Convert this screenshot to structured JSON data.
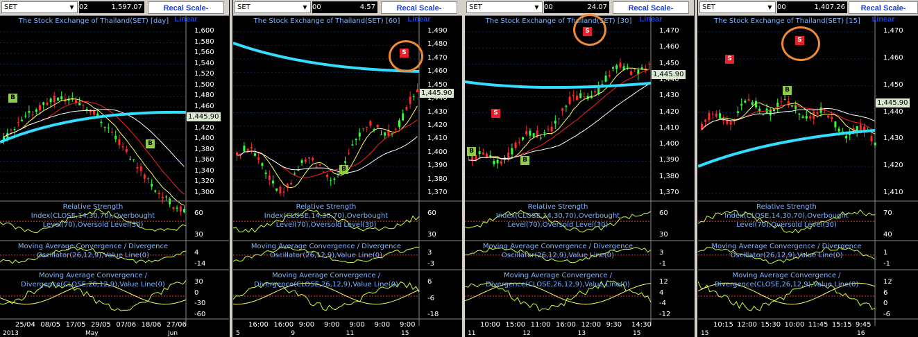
{
  "colors": {
    "accent": "#1a3fd6",
    "ma_fast": "#ffff66",
    "ma_mid": "#ff2020",
    "ma_slow": "#ffffff",
    "ma_long": "#33ddff",
    "signal_buy": "#8fcf3f",
    "signal_sell": "#e8202a",
    "highlight_ring": "#f08a35"
  },
  "panels": [
    {
      "symbol": "SET",
      "prev": "02",
      "value": "1,597.07",
      "recal": "Recal Scale-Linear",
      "title": "The Stock Exchange of Thailand(SET) [day]",
      "yticks": [
        "1,600",
        "1,580",
        "1,560",
        "1,540",
        "1,520",
        "1,500",
        "1,480",
        "1,460",
        "1,440",
        "1,420",
        "1,400",
        "1,380",
        "1,360",
        "1,340",
        "1,320",
        "1,300"
      ],
      "price": "1,445.90",
      "rsi": {
        "label": "Relative Strength Index(CLOSE,14,30,70),Overbought Level(70),Oversold Level(30)",
        "ticks": [
          "60",
          "30"
        ]
      },
      "osc": {
        "label": "Moving Average Convergence / Divergence Oscillator(26,12,9),Value Line(0)",
        "ticks": [
          "4",
          "-14"
        ]
      },
      "macd": {
        "label": "Moving Average Convergence / Divergence(CLOSE,26,12,9),Value Line(0)",
        "ticks": [
          "30",
          "0",
          "-30",
          "-60"
        ]
      },
      "xticks": [
        "25/04",
        "08/05",
        "17/05",
        "29/05",
        "07/06",
        "18/06",
        "27/06"
      ],
      "xsub": [
        "2013",
        "May",
        "Jun"
      ]
    },
    {
      "symbol": "SET",
      "prev": "00",
      "value": "4.57",
      "recal": "Recal Scale-Linear",
      "title": "The Stock Exchange of Thailand(SET) [60]",
      "yticks": [
        "1,490",
        "1,480",
        "1,470",
        "1,460",
        "1,450",
        "1,440",
        "1,430",
        "1,420",
        "1,410",
        "1,400",
        "1,390",
        "1,380",
        "1,370"
      ],
      "price": "1,445.90",
      "rsi": {
        "label": "Relative Strength Index(CLOSE,14,30,70),Overbought Level(70),Oversold Level(30)",
        "ticks": [
          "60",
          "30"
        ]
      },
      "osc": {
        "label": "Moving Average Convergence / Divergence Oscillator(26,12,9),Value Line(0)",
        "ticks": [
          "3",
          "-3"
        ]
      },
      "macd": {
        "label": "Moving Average Convergence / Divergence(CLOSE,26,12,9),Value Line(0)",
        "ticks": [
          "6",
          "-6",
          "-18"
        ]
      },
      "xticks": [
        "16:00",
        "16:00",
        "9:00",
        "9:00",
        "9:00",
        "9:00",
        "9:00"
      ],
      "xsub": [
        "5",
        "9",
        "11",
        "15"
      ]
    },
    {
      "symbol": "SET",
      "prev": "00",
      "value": "24.07",
      "recal": "Recal Scale-Linear",
      "title": "The Stock Exchange of Thailand(SET) [30]",
      "yticks": [
        "1,470",
        "1,460",
        "1,450",
        "1,440",
        "1,430",
        "1,420",
        "1,410",
        "1,400",
        "1,390",
        "1,380",
        "1,370"
      ],
      "price": "1,445.90",
      "rsi": {
        "label": "Relative Strength Index(CLOSE,14,30,70),Overbought Level(70),Oversold Level(30)",
        "ticks": [
          "60",
          "30"
        ]
      },
      "osc": {
        "label": "Moving Average Convergence / Divergence Oscillator(26,12,9),Value Line(0)",
        "ticks": [
          "3",
          "-1"
        ]
      },
      "macd": {
        "label": "Moving Average Convergence / Divergence(CLOSE,26,12,9),Value Line(0)",
        "ticks": [
          "12",
          "4",
          "-4",
          "-12"
        ]
      },
      "xticks": [
        "10:00",
        "15:00",
        "11:00",
        "16:00",
        "12:00",
        "9:30",
        "14:30"
      ],
      "xsub": [
        "11",
        "12",
        "13",
        "15"
      ]
    },
    {
      "symbol": "SET",
      "prev": "00",
      "value": "1,407.26",
      "recal": "Recal Scale-Linear",
      "title": "The Stock Exchange of Thailand(SET) [15]",
      "yticks": [
        "1,470",
        "1,460",
        "1,450",
        "1,440",
        "1,430",
        "1,420",
        "1,410"
      ],
      "price": "1,445.90",
      "rsi": {
        "label": "Relative Strength Index(CLOSE,14,30,70),Overbought Level(70),Oversold Level(30)",
        "ticks": [
          "70",
          "40"
        ]
      },
      "osc": {
        "label": "Moving Average Convergence / Divergence Oscillator(26,12,9),Value Line(0)",
        "ticks": [
          "1",
          "-1"
        ]
      },
      "macd": {
        "label": "Moving Average Convergence / Divergence(CLOSE,26,12,9),Value Line(0)",
        "ticks": [
          "12",
          "6",
          "0",
          "-6"
        ]
      },
      "xticks": [
        "10:15",
        "12:00",
        "15:30",
        "10:00",
        "11:45",
        "15:15",
        "9:45"
      ],
      "xsub": [
        "15",
        "16"
      ]
    }
  ]
}
